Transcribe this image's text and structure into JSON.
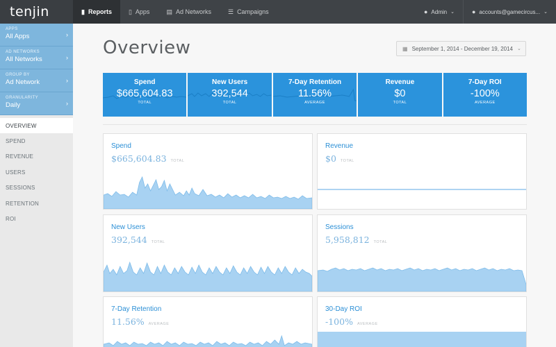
{
  "app": {
    "logo": "tenjin"
  },
  "nav": {
    "items": [
      {
        "label": "Reports",
        "icon": "bar-chart-icon",
        "active": true
      },
      {
        "label": "Apps",
        "icon": "phone-icon",
        "active": false
      },
      {
        "label": "Ad Networks",
        "icon": "book-icon",
        "active": false
      },
      {
        "label": "Campaigns",
        "icon": "list-icon",
        "active": false
      }
    ],
    "right": [
      {
        "label": "Admin",
        "icon": "lock-icon"
      },
      {
        "label": "accounts@gamecircus...",
        "icon": "user-icon"
      }
    ]
  },
  "sidebar": {
    "filters": [
      {
        "label": "APPS",
        "value": "All Apps"
      },
      {
        "label": "AD NETWORKS",
        "value": "All Networks"
      },
      {
        "label": "GROUP BY",
        "value": "Ad Network"
      },
      {
        "label": "GRANULARITY",
        "value": "Daily"
      }
    ],
    "items": [
      {
        "label": "OVERVIEW",
        "active": true
      },
      {
        "label": "SPEND",
        "active": false
      },
      {
        "label": "REVENUE",
        "active": false
      },
      {
        "label": "USERS",
        "active": false
      },
      {
        "label": "SESSIONS",
        "active": false
      },
      {
        "label": "RETENTION",
        "active": false
      },
      {
        "label": "ROI",
        "active": false
      }
    ]
  },
  "main": {
    "title": "Overview",
    "date_range": "September 1, 2014 - December 19, 2014",
    "kpis": [
      {
        "title": "Spend",
        "value": "$665,604.83",
        "sub": "TOTAL"
      },
      {
        "title": "New Users",
        "value": "392,544",
        "sub": "TOTAL"
      },
      {
        "title": "7-Day Retention",
        "value": "11.56%",
        "sub": "AVERAGE"
      },
      {
        "title": "Revenue",
        "value": "$0",
        "sub": "TOTAL"
      },
      {
        "title": "7-Day ROI",
        "value": "-100%",
        "sub": "AVERAGE"
      }
    ],
    "cards": [
      {
        "title": "Spend",
        "value": "$665,604.83",
        "sub": "TOTAL"
      },
      {
        "title": "Revenue",
        "value": "$0",
        "sub": "TOTAL"
      },
      {
        "title": "New Users",
        "value": "392,544",
        "sub": "TOTAL"
      },
      {
        "title": "Sessions",
        "value": "5,958,812",
        "sub": "TOTAL"
      },
      {
        "title": "7-Day Retention",
        "value": "11.56%",
        "sub": "AVERAGE"
      },
      {
        "title": "30-Day ROI",
        "value": "-100%",
        "sub": "AVERAGE"
      }
    ]
  },
  "colors": {
    "accent": "#2b93dc",
    "sidebar_filter": "#7eb6dd",
    "topbar": "#3f4347",
    "chart_fill": "#a8d2f2"
  }
}
